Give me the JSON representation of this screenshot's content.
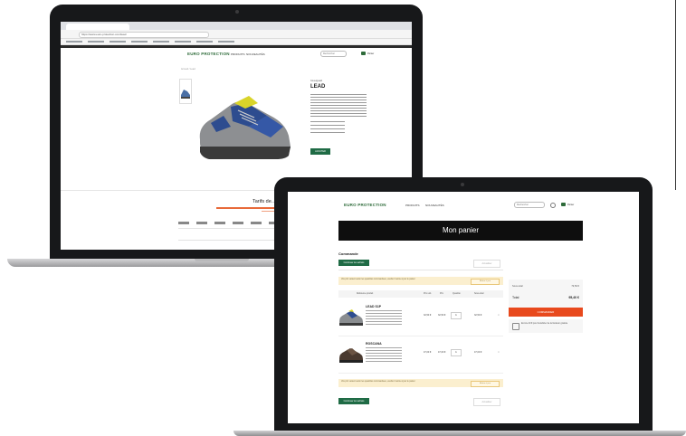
{
  "back_laptop": {
    "browser_url": "https://www.euro-protection.com/lead",
    "logo": "EURO PROTECTION",
    "nav": [
      "PRODUITS",
      "NOUVEAUTÉS"
    ],
    "search_placeholder": "Rechercher",
    "cart_label": "Panier",
    "breadcrumb": "Accueil / Lead",
    "product": {
      "brand": "Coverguard",
      "title": "LEAD",
      "add_button": "AJOUTER"
    },
    "section_title": "Tarifs de..."
  },
  "front_laptop": {
    "logo": "EURO PROTECTION",
    "nav": [
      "PRODUITS",
      "NOUVEAUTÉS"
    ],
    "search_placeholder": "Rechercher",
    "cart_label": "Panier",
    "hero_title": "Mon panier",
    "section_title": "Commande",
    "continue_button": "Continuer les achats",
    "update_button": "Actualiser",
    "notice_text": "Vos prix varient selon les quantités commandées, veuillez mettre à jour le panier",
    "notice_button": "Mettre à jour",
    "table_headers": [
      "Référence produit",
      "Prix unit.",
      "Prix",
      "Quantité",
      "Sous-total"
    ],
    "items": [
      {
        "name": "LEAD S1P",
        "unit_price": "32,50 €",
        "price": "32,50 €",
        "qty": "1",
        "subtotal": "32,50 €"
      },
      {
        "name": "ROSCANA",
        "unit_price": "47,00 €",
        "price": "47,00 €",
        "qty": "1",
        "subtotal": "47,00 €"
      }
    ],
    "summary": {
      "subtotal_label": "Sous-total",
      "subtotal_value": "79,50 €",
      "total_label": "Total",
      "total_value": "95,40 €",
      "checkout_button": "COMMANDER",
      "info_text": "Encore 20 € pour bénéficier de la livraison gratuite"
    }
  },
  "colors": {
    "brand_green": "#1f6b45",
    "checkout_orange": "#e8491d",
    "notice_bg": "#fbefcf"
  }
}
